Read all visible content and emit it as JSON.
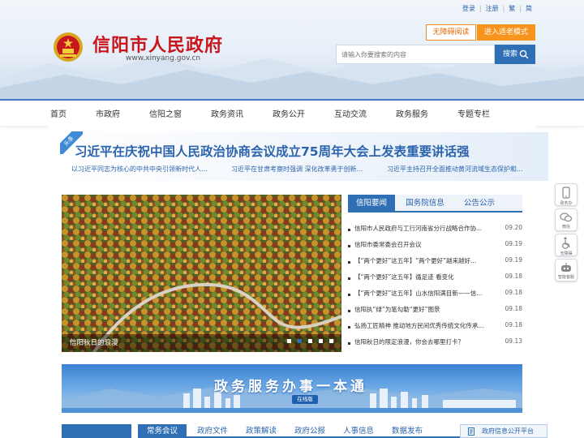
{
  "header": {
    "top_links": [
      "登录",
      "注册",
      "繁",
      "简"
    ],
    "site_title": "信阳市人民政府",
    "site_url": "www.xinyang.gov.cn",
    "accessibility_label": "无障碍阅读",
    "elder_mode_label": "进入适老模式",
    "search_placeholder": "请输入你要搜索的内容",
    "search_button": "搜索"
  },
  "nav": {
    "items": [
      "首页",
      "市政府",
      "信阳之窗",
      "政务资讯",
      "政务公开",
      "互动交流",
      "政务服务",
      "专题专栏"
    ]
  },
  "headline": {
    "tag": "头条",
    "title": "习近平在庆祝中国人民政治协商会议成立75周年大会上发表重要讲话强",
    "sub_links": [
      "以习近平同志为核心的中共中央引领新时代人...",
      "习近平在甘肃考察时强调 深化改革勇于创新...",
      "习近平主持召开全面推动黄河流域生态保护和..."
    ]
  },
  "photo": {
    "caption": "信阳秋日的浪漫",
    "slide_count": 5,
    "active_slide": 2
  },
  "news_tabs": {
    "tabs": [
      "信阳要闻",
      "国务院信息",
      "公告公示"
    ],
    "active": 0,
    "items": [
      {
        "title": "信阳市人民政府与工行河南省分行战略合作协...",
        "date": "09.20"
      },
      {
        "title": "信阳市委常委会召开会议",
        "date": "09.19"
      },
      {
        "title": "【“两个更好”这五年】“两个更好”越来越好...",
        "date": "09.19"
      },
      {
        "title": "【“两个更好”这五年】循足迹 看变化",
        "date": "09.18"
      },
      {
        "title": "【“两个更好”这五年】山水信阳满目新——信...",
        "date": "09.18"
      },
      {
        "title": "信阳执“绿”为笔勾勒“更好”图景",
        "date": "09.18"
      },
      {
        "title": "弘扬工匠精神 推动地方民间优秀传统文化传承...",
        "date": "09.18"
      },
      {
        "title": "信阳秋日的限定浪漫，你会去哪里打卡？",
        "date": "09.13"
      }
    ]
  },
  "banner": {
    "title": "政务服务办事一本通",
    "badge": "在线版"
  },
  "bottom_tabs": {
    "tabs": [
      "常务会议",
      "政府文件",
      "政策解读",
      "政府公报",
      "人事信息",
      "数据发布"
    ],
    "active": 0,
    "right_box": "政府信息公开平台"
  },
  "side_tools": [
    "政务办",
    "微信",
    "无障碍",
    "智能客服"
  ],
  "colors": {
    "brand_red": "#c8161d",
    "brand_blue": "#2f6fb6",
    "accent_orange": "#f7941d"
  }
}
